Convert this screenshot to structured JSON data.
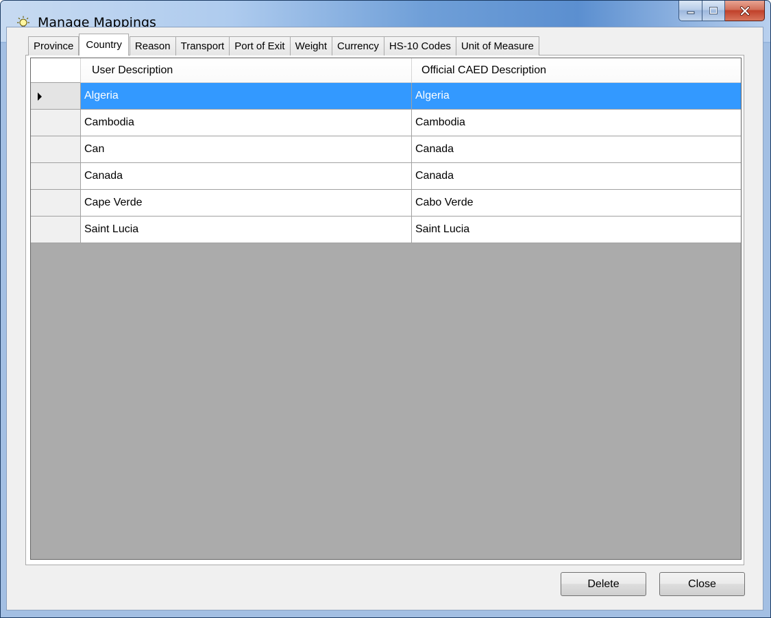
{
  "window": {
    "title": "Manage Mappings",
    "icon": "lightbulb-icon",
    "controls": {
      "minimize": "minimize-icon",
      "maximize": "maximize-icon",
      "close": "close-icon"
    }
  },
  "tabs": [
    {
      "label": "Province",
      "active": false
    },
    {
      "label": "Country",
      "active": true
    },
    {
      "label": "Reason",
      "active": false
    },
    {
      "label": "Transport",
      "active": false
    },
    {
      "label": "Port of Exit",
      "active": false
    },
    {
      "label": "Weight",
      "active": false
    },
    {
      "label": "Currency",
      "active": false
    },
    {
      "label": "HS-10 Codes",
      "active": false
    },
    {
      "label": "Unit of Measure",
      "active": false
    }
  ],
  "grid": {
    "columns": [
      "User Description",
      "Official CAED Description"
    ],
    "rows": [
      {
        "user": "Algeria",
        "official": "Algeria",
        "selected": true
      },
      {
        "user": "Cambodia",
        "official": "Cambodia",
        "selected": false
      },
      {
        "user": "Can",
        "official": "Canada",
        "selected": false
      },
      {
        "user": "Canada",
        "official": "Canada",
        "selected": false
      },
      {
        "user": "Cape Verde",
        "official": "Cabo Verde",
        "selected": false
      },
      {
        "user": "Saint Lucia",
        "official": "Saint Lucia",
        "selected": false
      }
    ],
    "selection_color": "#3399ff"
  },
  "buttons": {
    "delete": "Delete",
    "close": "Close"
  }
}
